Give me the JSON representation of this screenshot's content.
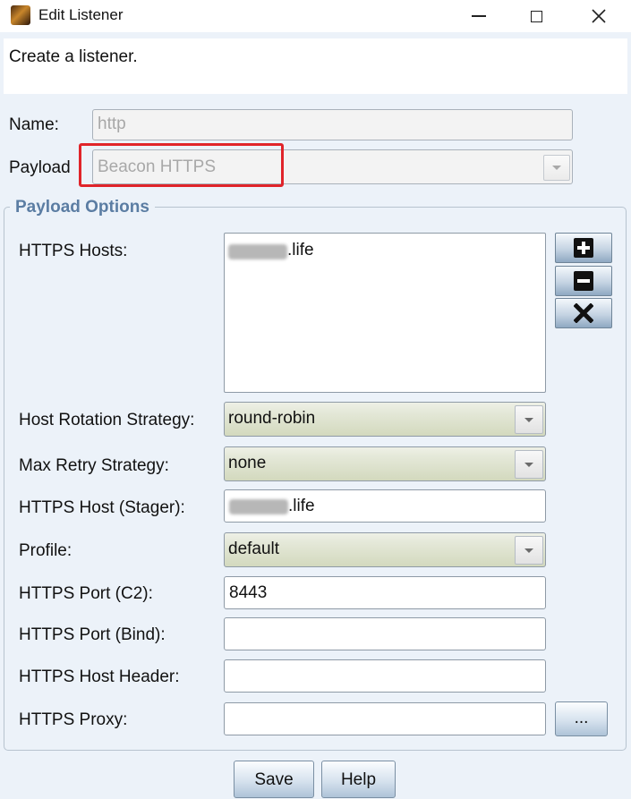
{
  "window": {
    "title": "Edit Listener",
    "description": "Create a listener.",
    "icons": {
      "app": "app-icon",
      "minimize": "minimize-icon",
      "maximize": "maximize-icon",
      "close": "close-icon"
    }
  },
  "form": {
    "name_label": "Name:",
    "name_value": "http",
    "payload_label": "Payload",
    "payload_value": "Beacon HTTPS"
  },
  "payload_options": {
    "legend": "Payload Options",
    "https_hosts_label": "HTTPS Hosts:",
    "https_hosts": [
      ".life"
    ],
    "host_actions": [
      "plus-icon",
      "minus-icon",
      "x-icon"
    ],
    "host_rotation_label": "Host Rotation Strategy:",
    "host_rotation_value": "round-robin",
    "max_retry_label": "Max Retry Strategy:",
    "max_retry_value": "none",
    "stager_host_label": "HTTPS Host (Stager):",
    "stager_host_value": ".life",
    "profile_label": "Profile:",
    "profile_value": "default",
    "port_c2_label": "HTTPS Port (C2):",
    "port_c2_value": "8443",
    "port_bind_label": "HTTPS Port (Bind):",
    "port_bind_value": "",
    "host_header_label": "HTTPS Host Header:",
    "host_header_value": "",
    "proxy_label": "HTTPS Proxy:",
    "proxy_value": "",
    "proxy_button_label": "..."
  },
  "buttons": {
    "save": "Save",
    "help": "Help"
  },
  "colors": {
    "highlight_box": "#e0242a",
    "legend_text": "#5b7da3",
    "combo_fill": "#dde2cb"
  }
}
